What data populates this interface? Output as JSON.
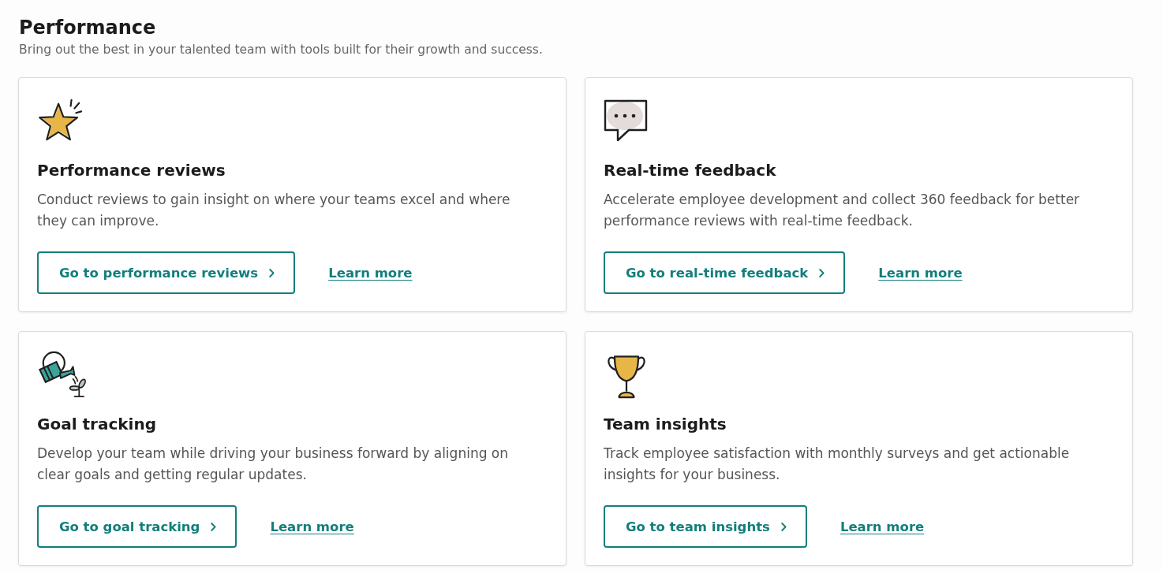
{
  "header": {
    "title": "Performance",
    "subtitle": "Bring out the best in your talented team with tools built for their growth and success."
  },
  "cards": [
    {
      "title": "Performance reviews",
      "description": "Conduct reviews to gain insight on where your teams excel and where they can improve.",
      "button": "Go to performance reviews",
      "link": "Learn more"
    },
    {
      "title": "Real-time feedback",
      "description": "Accelerate employee development and collect 360 feedback for better performance reviews with real-time feedback.",
      "button": "Go to real-time feedback",
      "link": "Learn more"
    },
    {
      "title": "Goal tracking",
      "description": "Develop your team while driving your business forward by aligning on clear goals and getting regular updates.",
      "button": "Go to goal tracking",
      "link": "Learn more"
    },
    {
      "title": "Team insights",
      "description": "Track employee satisfaction with monthly surveys and get actionable insights for your business.",
      "button": "Go to team insights",
      "link": "Learn more"
    }
  ]
}
